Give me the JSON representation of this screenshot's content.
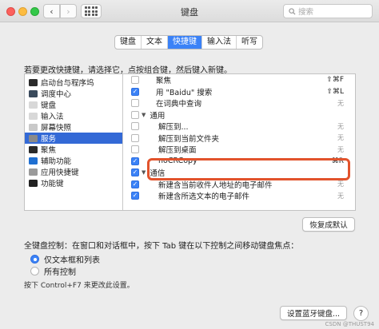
{
  "window": {
    "title": "键盘",
    "search_placeholder": "搜索"
  },
  "tabs": [
    {
      "label": "键盘",
      "active": false
    },
    {
      "label": "文本",
      "active": false
    },
    {
      "label": "快捷键",
      "active": true
    },
    {
      "label": "输入法",
      "active": false
    },
    {
      "label": "听写",
      "active": false
    }
  ],
  "instruction": "若要更改快捷键，请选择它，点按组合键，然后键入新键。",
  "categories": [
    {
      "label": "启动台与程序坞",
      "icon": "launchpad-icon",
      "color": "#2b2b2b"
    },
    {
      "label": "调度中心",
      "icon": "mission-control-icon",
      "color": "#3a4a5c"
    },
    {
      "label": "键盘",
      "icon": "keyboard-icon",
      "color": "#d8d8d8"
    },
    {
      "label": "输入法",
      "icon": "input-source-icon",
      "color": "#d8d8d8"
    },
    {
      "label": "屏幕快照",
      "icon": "screenshot-icon",
      "color": "#c9c9c9"
    },
    {
      "label": "服务",
      "icon": "gear-icon",
      "color": "#8a8a8a",
      "selected": true
    },
    {
      "label": "聚焦",
      "icon": "spotlight-icon",
      "color": "#2a2a2a"
    },
    {
      "label": "辅助功能",
      "icon": "accessibility-icon",
      "color": "#1f6fd1"
    },
    {
      "label": "应用快捷键",
      "icon": "app-shortcut-icon",
      "color": "#9a9a9a"
    },
    {
      "label": "功能键",
      "icon": "fn-key-icon",
      "color": "#222222"
    }
  ],
  "shortcuts": [
    {
      "label": "聚焦",
      "checked": false,
      "shortcut": "⇧⌘F",
      "kind": "item"
    },
    {
      "label": "用 \"Baidu\" 搜索",
      "checked": true,
      "shortcut": "⇧⌘L",
      "kind": "item"
    },
    {
      "label": "在词典中查询",
      "checked": false,
      "shortcut": "无",
      "kind": "item"
    },
    {
      "label": "通用",
      "checked": false,
      "shortcut": "",
      "kind": "group"
    },
    {
      "label": "解压到...",
      "checked": false,
      "shortcut": "无",
      "kind": "subitem"
    },
    {
      "label": "解压到当前文件夹",
      "checked": false,
      "shortcut": "无",
      "kind": "subitem"
    },
    {
      "label": "解压到桌面",
      "checked": false,
      "shortcut": "无",
      "kind": "subitem"
    },
    {
      "label": "noCRCopy",
      "checked": true,
      "shortcut": "⌘R",
      "kind": "subitem"
    },
    {
      "label": "通信",
      "checked": true,
      "shortcut": "",
      "kind": "group"
    },
    {
      "label": "新建含当前收件人地址的电子邮件",
      "checked": true,
      "shortcut": "无",
      "kind": "subitem"
    },
    {
      "label": "新建含所选文本的电子邮件",
      "checked": true,
      "shortcut": "无",
      "kind": "subitem"
    }
  ],
  "buttons": {
    "restore_defaults": "恢复成默认",
    "bluetooth": "设置蓝牙键盘...",
    "help": "?"
  },
  "full_keyboard": {
    "label": "全键盘控制：在窗口和对话框中，按下 Tab 键在以下控制之间移动键盘焦点：",
    "options": [
      {
        "label": "仅文本框和列表",
        "selected": true
      },
      {
        "label": "所有控制",
        "selected": false
      }
    ],
    "hint": "按下 Control+F7 来更改此设置。"
  },
  "watermark": "CSDN @THUST94"
}
